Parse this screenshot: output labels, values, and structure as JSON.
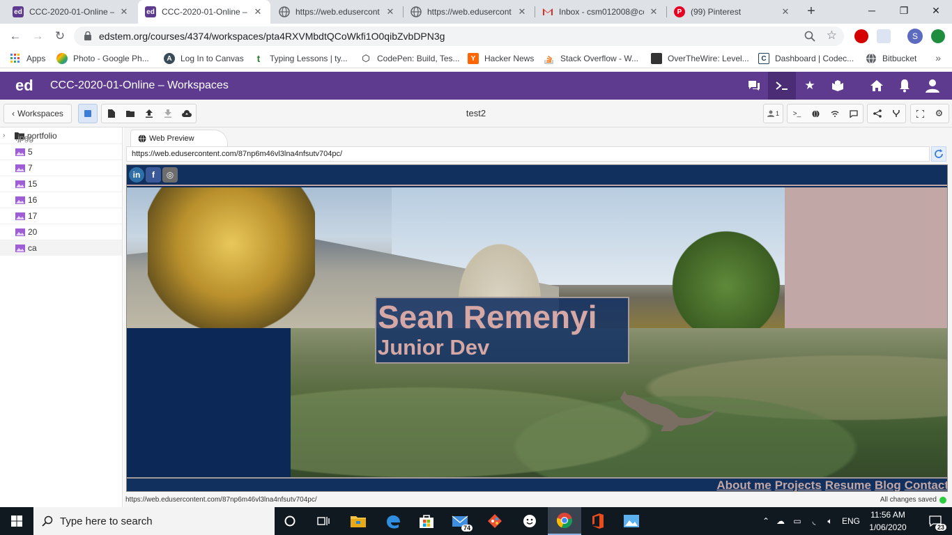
{
  "browser": {
    "tabs": [
      {
        "title": "CCC-2020-01-Online –",
        "icon": "ed-icon",
        "color": "#5e3b8f",
        "active": false
      },
      {
        "title": "CCC-2020-01-Online – ",
        "icon": "ed-icon",
        "color": "#5e3b8f",
        "active": true
      },
      {
        "title": "https://web.edusercont",
        "icon": "globe-icon",
        "color": "#5f6368",
        "active": false
      },
      {
        "title": "https://web.edusercont",
        "icon": "globe-icon",
        "color": "#5f6368",
        "active": false
      },
      {
        "title": "Inbox - csm012008@co",
        "icon": "gmail-icon",
        "color": "#d93025",
        "active": false
      },
      {
        "title": "(99) Pinterest",
        "icon": "pinterest-icon",
        "color": "#e60023",
        "active": false
      }
    ],
    "new_tab_glyph": "+",
    "window_controls": {
      "minimize": "─",
      "maximize": "❐",
      "close": "✕"
    },
    "url": "edstem.org/courses/4374/workspaces/pta4RXVMbdtQCoWkfi1O0qibZvbDPN3g",
    "profile_initial": "S",
    "bookmarks": [
      {
        "label": "Apps",
        "icon": "apps-grid-icon",
        "color": "#4285f4"
      },
      {
        "label": "Photo - Google Ph...",
        "icon": "google-photos-icon",
        "color": "#fbbc04"
      },
      {
        "label": "Log In to Canvas",
        "icon": "canvas-icon",
        "color": "#394b58"
      },
      {
        "label": "Typing Lessons | ty...",
        "icon": "typing-icon",
        "color": "#2e7d32"
      },
      {
        "label": "CodePen: Build, Tes...",
        "icon": "codepen-icon",
        "color": "#111111"
      },
      {
        "label": "Hacker News",
        "icon": "hacker-news-icon",
        "color": "#ff6600"
      },
      {
        "label": "Stack Overflow - W...",
        "icon": "stackoverflow-icon",
        "color": "#f48024"
      },
      {
        "label": "OverTheWire: Level...",
        "icon": "overthewire-icon",
        "color": "#333333"
      },
      {
        "label": "Dashboard | Codec...",
        "icon": "codecademy-icon",
        "color": "#1f4056"
      },
      {
        "label": "Bitbucket",
        "icon": "globe-icon",
        "color": "#5f6368"
      }
    ],
    "bookmarks_more": "»"
  },
  "ed": {
    "logo": "ed",
    "title": "CCC-2020-01-Online – Workspaces",
    "header_icons": [
      "discussion-icon",
      "terminal-icon",
      "star-icon",
      "lessons-icon",
      "home-icon",
      "bell-icon",
      "user-icon"
    ],
    "brand_color": "#5e3b8f"
  },
  "workspace": {
    "back_label": "Workspaces",
    "title": "test2",
    "users_count": "1"
  },
  "files": {
    "folder": "portfolio",
    "items": [
      {
        "name": "5",
        "ext": ".jpeg"
      },
      {
        "name": "7",
        "ext": ".jpeg"
      },
      {
        "name": "15",
        "ext": ".jpeg"
      },
      {
        "name": "16",
        "ext": ".jpeg"
      },
      {
        "name": "17",
        "ext": ".jpeg"
      },
      {
        "name": "20",
        "ext": ".jpeg"
      },
      {
        "name": "ca",
        "ext": ".jpg"
      }
    ]
  },
  "preview": {
    "tab_label": "Web Preview",
    "url": "https://web.edusercontent.com/87np6m46vl3lna4nfsutv704pc/",
    "status_url": "https://web.edusercontent.com/87np6m46vl3lna4nfsutv704pc/",
    "saved_text": "All changes saved"
  },
  "site": {
    "social": [
      {
        "label": "in",
        "icon": "linkedin-icon",
        "color": "#2f6fa8"
      },
      {
        "label": "f",
        "icon": "facebook-icon",
        "color": "#3b5998"
      },
      {
        "label": "◎",
        "icon": "instagram-icon",
        "color": "#6d6d6d"
      }
    ],
    "name": "Sean Remenyi",
    "role": "Junior Dev",
    "nav": [
      "About me",
      "Projects",
      "Resume",
      "Blog",
      "Contact"
    ],
    "accent": "#d5a7a5",
    "navy": "#0b2856"
  },
  "taskbar": {
    "search_placeholder": "Type here to search",
    "mail_badge": "74",
    "language": "ENG",
    "time": "11:56 AM",
    "date": "1/06/2020",
    "notification_count": "23"
  }
}
